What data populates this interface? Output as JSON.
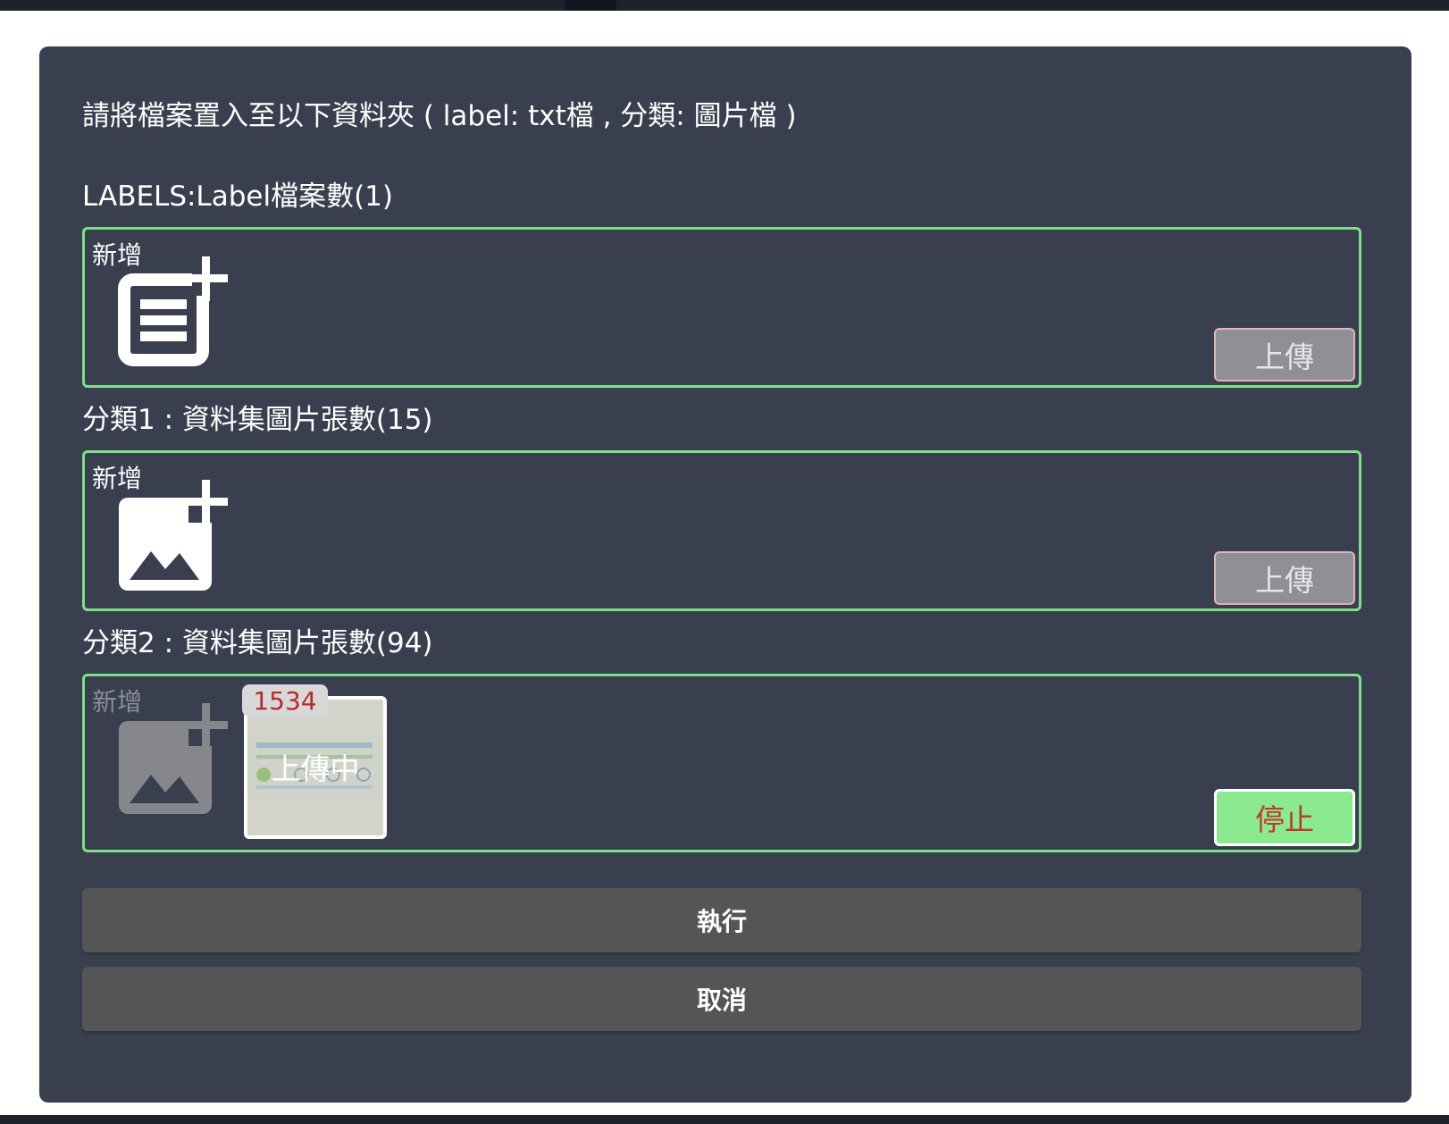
{
  "dialog": {
    "instruction": "請將檔案置入至以下資料夾 ( label: txt檔 , 分類: 圖片檔 )"
  },
  "sections": [
    {
      "title": "LABELS:Label檔案數(1)",
      "add_label": "新增",
      "add_icon": "add-document-icon",
      "button_label": "上傳"
    },
    {
      "title": "分類1 : 資料集圖片張數(15)",
      "add_label": "新增",
      "add_icon": "add-image-icon",
      "button_label": "上傳"
    },
    {
      "title": "分類2 : 資料集圖片張數(94)",
      "add_label": "新增",
      "add_icon": "add-image-icon",
      "button_label": "停止",
      "thumbnail": {
        "badge": "1534",
        "status": "上傳中"
      }
    }
  ],
  "actions": {
    "execute_label": "執行",
    "cancel_label": "取消"
  },
  "colors": {
    "dialog_bg": "#3a3f4f",
    "dropzone_border": "#7fe08a",
    "stop_bg": "#8be98f",
    "stop_text": "#c0392b",
    "action_bg": "#555555"
  }
}
